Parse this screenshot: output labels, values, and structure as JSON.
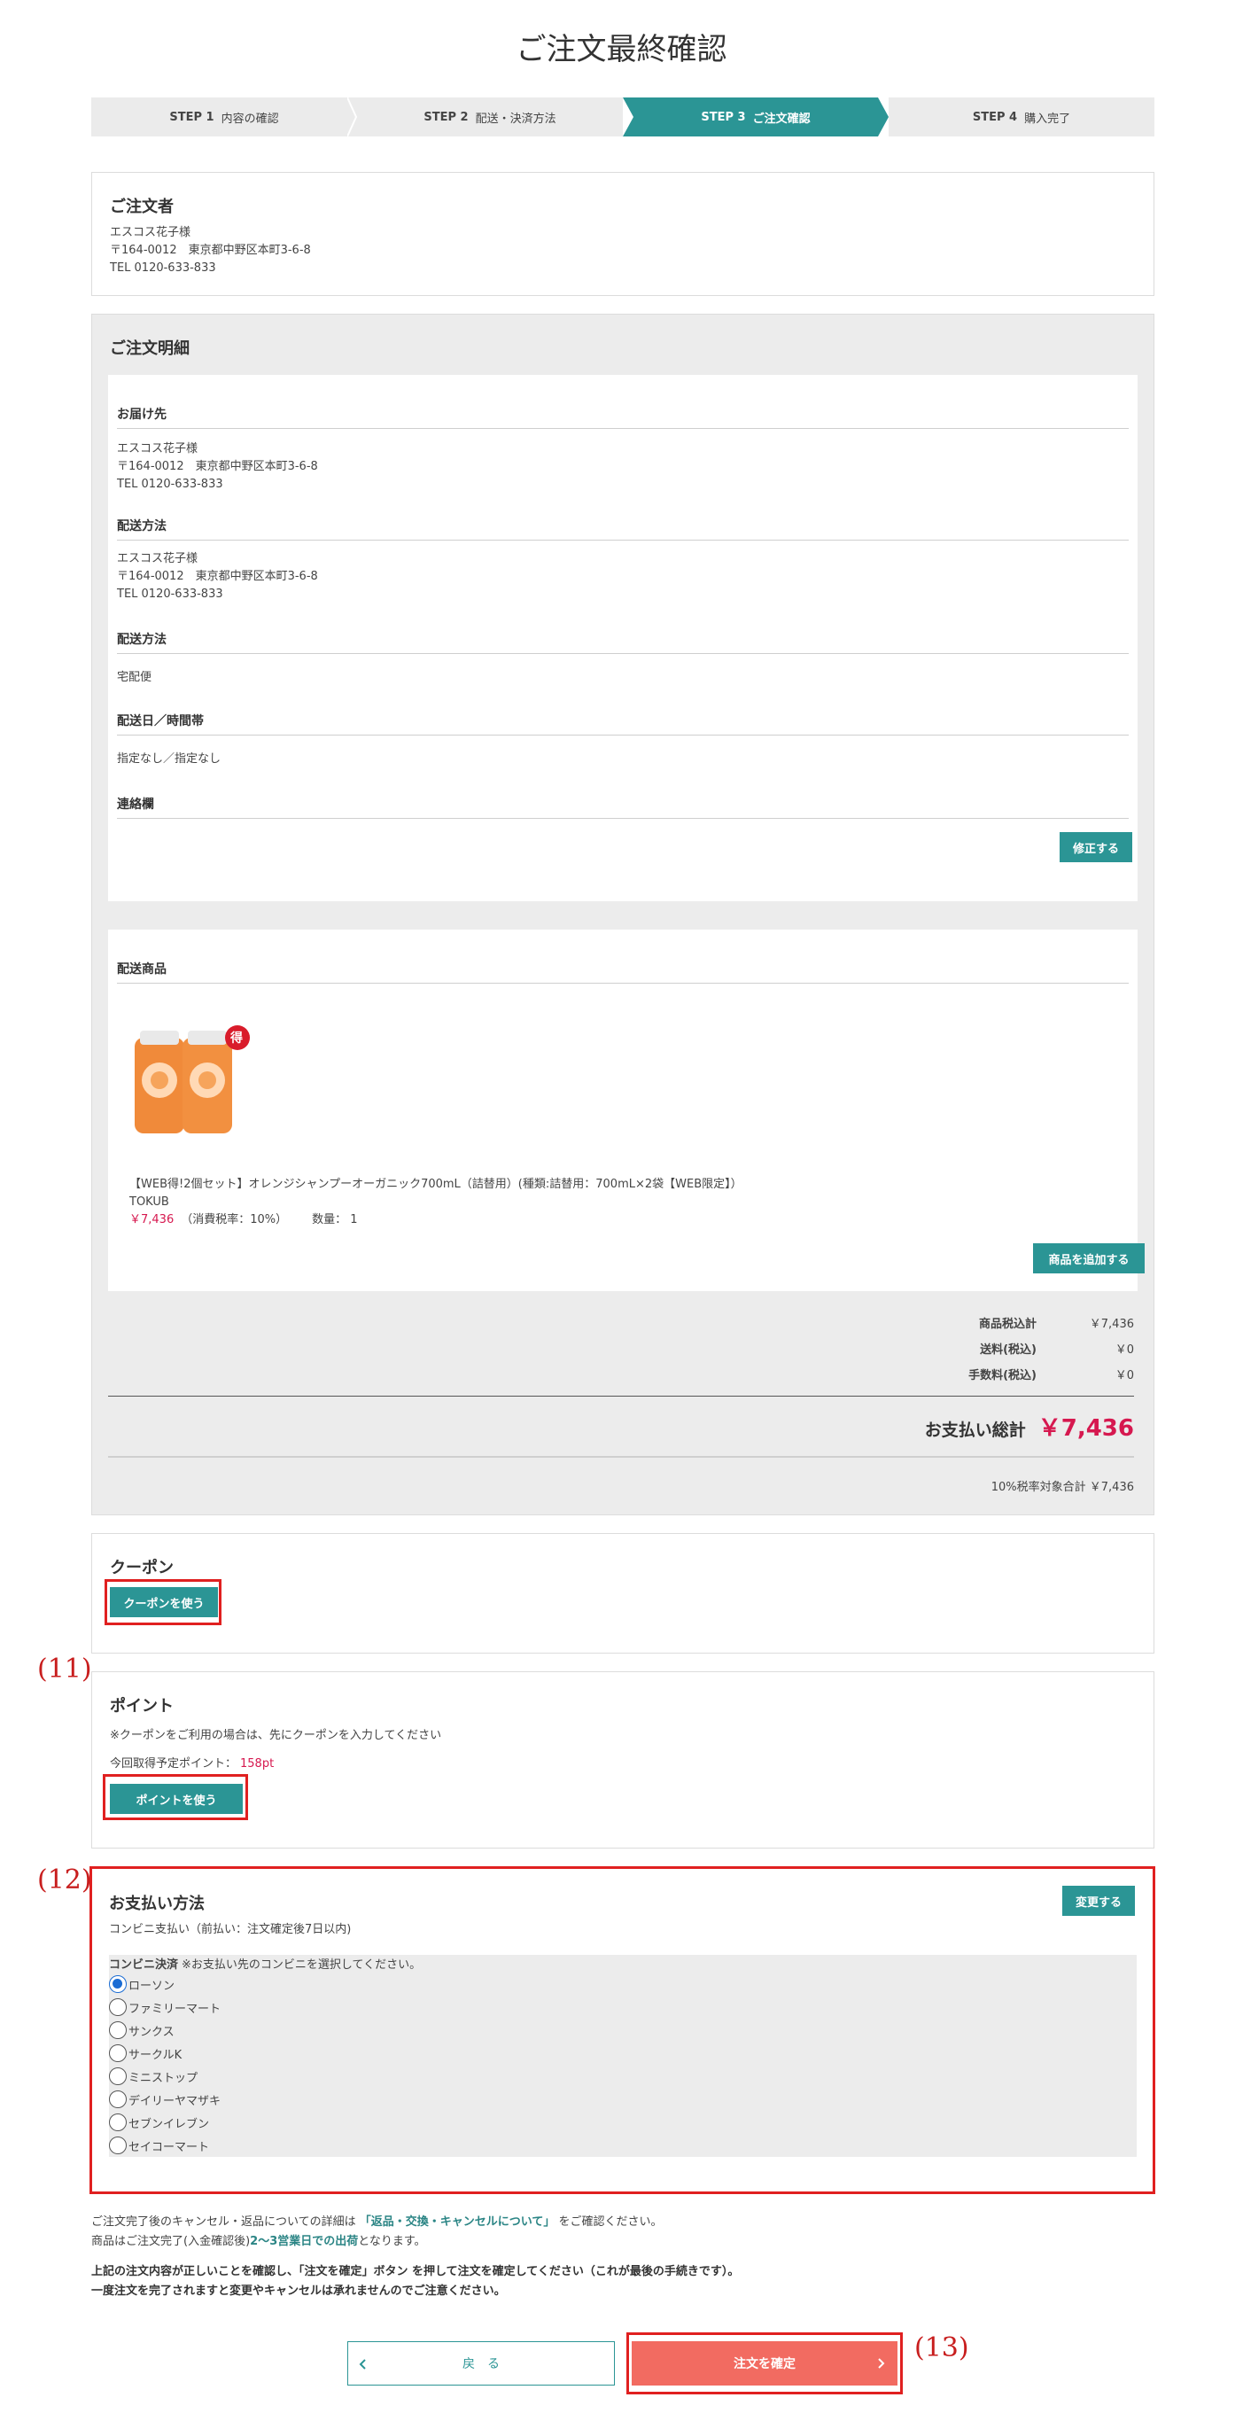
{
  "page": {
    "title": "ご注文最終確認"
  },
  "steps": [
    {
      "num": "STEP 1",
      "label": "内容の確認"
    },
    {
      "num": "STEP 2",
      "label": "配送・決済方法"
    },
    {
      "num": "STEP 3",
      "label": "ご注文確認"
    },
    {
      "num": "STEP 4",
      "label": "購入完了"
    }
  ],
  "orderer": {
    "heading": "ご注文者",
    "name": "エスコス花子様",
    "address": "〒164-0012　東京都中野区本町3-6-8",
    "tel": "TEL 0120-633-833"
  },
  "details": {
    "heading": "ご注文明細",
    "delivery_to": {
      "heading": "お届け先",
      "name": "エスコス花子様",
      "address": "〒164-0012　東京都中野区本町3-6-8",
      "tel": "TEL 0120-633-833"
    },
    "shipping_addr": {
      "heading": "配送方法",
      "name": "エスコス花子様",
      "address": "〒164-0012　東京都中野区本町3-6-8",
      "tel": "TEL 0120-633-833"
    },
    "shipping_method": {
      "heading": "配送方法",
      "value": "宅配便"
    },
    "delivery_date": {
      "heading": "配送日／時間帯",
      "value": "指定なし／指定なし"
    },
    "contact": {
      "heading": "連絡欄",
      "value": ""
    },
    "edit_button": "修正する",
    "items_heading": "配送商品",
    "product": {
      "badge": "得",
      "name": "【WEB得!2個セット】オレンジシャンプーオーガニック700mL（詰替用）(種類:詰替用：700mL×2袋【WEB限定】）",
      "brand": "TOKUB",
      "price": "￥7,436",
      "tax": "（消費税率：10%）",
      "qty": "数量： 1"
    },
    "add_button": "商品を追加する",
    "summary": [
      {
        "label": "商品税込計",
        "value": "￥7,436"
      },
      {
        "label": "送料(税込)",
        "value": "￥0"
      },
      {
        "label": "手数料(税込)",
        "value": "￥0"
      }
    ],
    "total_label": "お支払い総計",
    "total_value": "￥7,436",
    "tax_note": "10%税率対象合計 ￥7,436"
  },
  "coupon": {
    "heading": "クーポン",
    "button": "クーポンを使う"
  },
  "points": {
    "heading": "ポイント",
    "note": "※クーポンをご利用の場合は、先にクーポンを入力してください",
    "earn_label": "今回取得予定ポイント：",
    "earn_value": "158pt",
    "button": "ポイントを使う"
  },
  "payment": {
    "heading": "お支払い方法",
    "change_button": "変更する",
    "method": "コンビニ支払い（前払い：注文確定後7日以内)",
    "store_label": "コンビニ決済",
    "store_note": "※お支払い先のコンビニを選択してください。",
    "stores": [
      "ローソン",
      "ファミリーマート",
      "サンクス",
      "サークルK",
      "ミニストップ",
      "デイリーヤマザキ",
      "セブンイレブン",
      "セイコーマート"
    ],
    "selected": "ローソン"
  },
  "footer": {
    "line1_a": "ご注文完了後のキャンセル・返品についての詳細は",
    "line1_link": "「返品・交換・キャンセルについて」",
    "line1_b": "をご確認ください。",
    "line2_a": "商品はご注文完了(入金確認後)",
    "line2_em": "2〜3営業日での出荷",
    "line2_b": "となります。",
    "line3": "上記の注文内容が正しいことを確認し、「注文を確定」ボタン を押して注文を確定してください（これが最後の手続きです）。",
    "line4": "一度注文を完了されますと変更やキャンセルは承れませんのでご注意ください。",
    "back_button": "戻　る",
    "confirm_button": "注文を確定"
  },
  "annotations": {
    "a11": "(11)",
    "a12": "(12)",
    "a13": "(13)"
  },
  "colors": {
    "teal": "#2b9595",
    "price_red": "#d6184f",
    "confirm": "#f26b61",
    "annotation_red": "#e02020"
  }
}
